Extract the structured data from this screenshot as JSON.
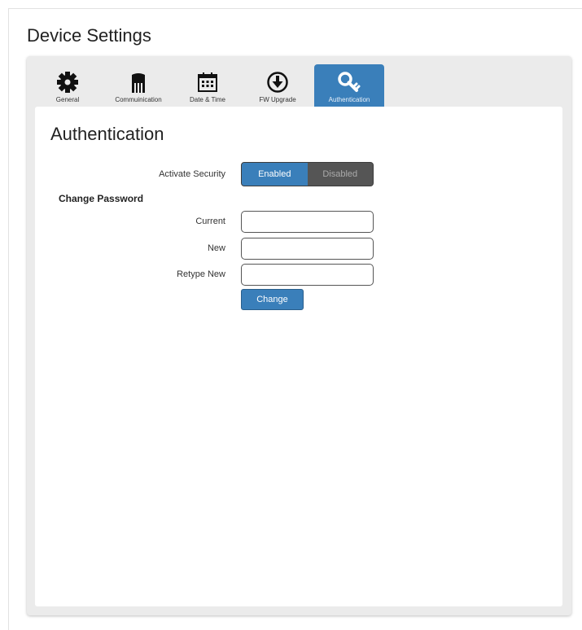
{
  "page": {
    "title": "Device Settings"
  },
  "tabs": [
    {
      "label": "General",
      "icon": "gear-icon",
      "active": false
    },
    {
      "label": "Commuinication",
      "icon": "ethernet-icon",
      "active": false
    },
    {
      "label": "Date & Time",
      "icon": "calendar-icon",
      "active": false
    },
    {
      "label": "FW Upgrade",
      "icon": "download-circle-icon",
      "active": false
    },
    {
      "label": "Authentication",
      "icon": "key-icon",
      "active": true
    }
  ],
  "auth": {
    "section_title": "Authentication",
    "activate_security_label": "Activate Security",
    "toggle": {
      "enabled_label": "Enabled",
      "disabled_label": "Disabled",
      "selected": "Enabled"
    },
    "change_password_heading": "Change Password",
    "fields": {
      "current_label": "Current",
      "current_value": "",
      "new_label": "New",
      "new_value": "",
      "retype_label": "Retype New",
      "retype_value": ""
    },
    "change_button_label": "Change"
  },
  "colors": {
    "accent": "#3a7fba",
    "toggle_off_bg": "#555555",
    "frame_bg": "#ebebeb"
  }
}
